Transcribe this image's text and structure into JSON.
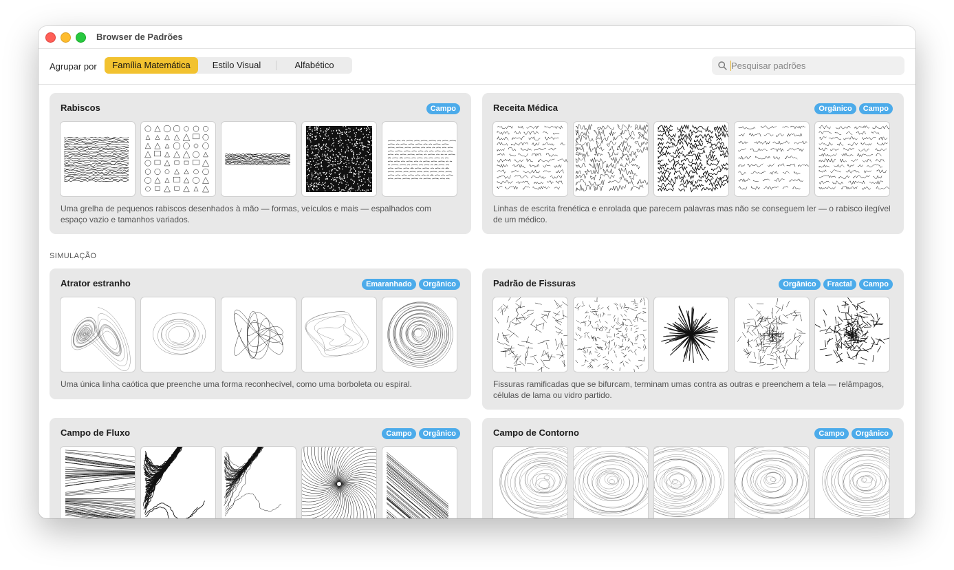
{
  "window": {
    "title": "Browser de Padrões"
  },
  "toolbar": {
    "group_label": "Agrupar por",
    "segments": [
      "Família Matemática",
      "Estilo Visual",
      "Alfabético"
    ],
    "selected": "Família Matemática",
    "search_placeholder": "Pesquisar padrões"
  },
  "colors": {
    "accent": "#f2c230",
    "tag": "#4cabea",
    "card": "#e8e8e8"
  },
  "section_label": "SIMULAÇÃO",
  "cards": [
    {
      "title": "Rabiscos",
      "tags": [
        "Campo"
      ],
      "thumbs": [
        "dense-grid",
        "doodle-grid",
        "strip",
        "noise",
        "text-lines"
      ],
      "description": "Uma grelha de pequenos rabiscos desenhados à mão — formas, veículos e mais — espalhados com espaço vazio e tamanhos variados."
    },
    {
      "title": "Receita Médica",
      "tags": [
        "Orgânico",
        "Campo"
      ],
      "thumbs": [
        "scribble-rows",
        "slanted",
        "dense-scribble",
        "sparse-scribble",
        "script-rows"
      ],
      "description": "Linhas de escrita frenética e enrolada que parecem palavras mas não se conseguem ler — o rabisco ilegível de um médico."
    },
    {
      "title": "Atrator estranho",
      "tags": [
        "Emaranhado",
        "Orgânico"
      ],
      "thumbs": [
        "lorenz",
        "spiral",
        "knot",
        "loops",
        "circles"
      ],
      "description": "Uma única linha caótica que preenche uma forma reconhecível, como uma borboleta ou espiral."
    },
    {
      "title": "Padrão de Fissuras",
      "tags": [
        "Orgânico",
        "Fractal",
        "Campo"
      ],
      "thumbs": [
        "cracks",
        "mud",
        "starburst",
        "branches",
        "web"
      ],
      "description": "Fissuras ramificadas que se bifurcam, terminam umas contra as outras e preenchem a tela — relâmpagos, células de lama ou vidro partido."
    },
    {
      "title": "Campo de Fluxo",
      "tags": [
        "Campo",
        "Orgânico"
      ],
      "thumbs": [
        "flow-lines",
        "cracked-flow",
        "river",
        "vortex",
        "diagonal"
      ],
      "description": ""
    },
    {
      "title": "Campo de Contorno",
      "tags": [
        "Campo",
        "Orgânico"
      ],
      "thumbs": [
        "contours-a",
        "contours-b",
        "contours-c",
        "contours-d",
        "contours-e"
      ],
      "description": ""
    }
  ]
}
